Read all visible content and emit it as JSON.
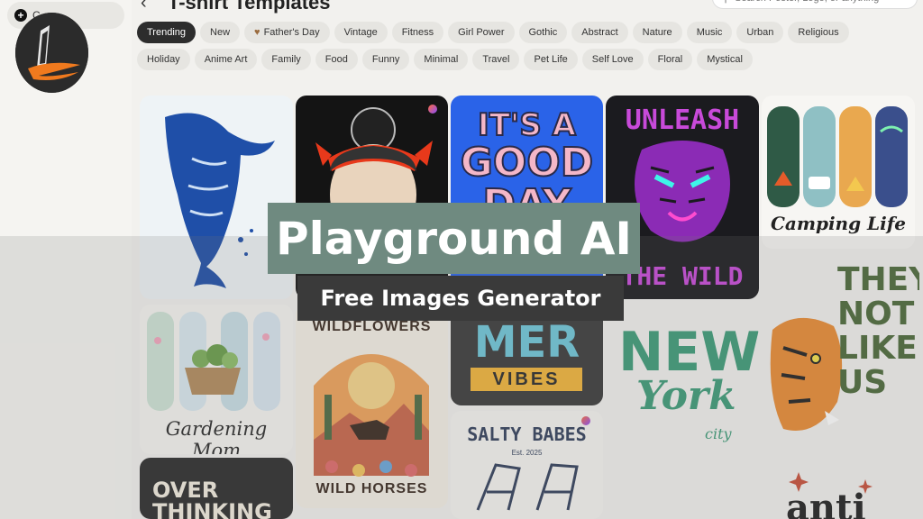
{
  "sidebar": {
    "create_label": "C"
  },
  "header": {
    "title": "T-shirt Templates",
    "search_placeholder": "Search Poster, Logo, or anything"
  },
  "chips_row1": [
    "Trending",
    "New",
    "Father's Day",
    "Vintage",
    "Fitness",
    "Girl Power",
    "Gothic",
    "Abstract",
    "Nature",
    "Music",
    "Urban",
    "Religious"
  ],
  "chips_row2": [
    "Holiday",
    "Anime Art",
    "Family",
    "Food",
    "Funny",
    "Minimal",
    "Travel",
    "Pet Life",
    "Self Love",
    "Floral",
    "Mystical"
  ],
  "active_chip": "Trending",
  "cards": {
    "good_day": [
      "IT'S A",
      "GOOD",
      "DAY"
    ],
    "unleash": "UNLEASH",
    "the_wild": "THE WILD",
    "camping": "Camping Life",
    "gardening": "Gardening Mom",
    "wildflowers": "WILDFLOWERS",
    "wild_horses": "WILD HORSES",
    "mer_vibes_top": "MER",
    "mer_vibes_bottom": "VIBES",
    "new_york": [
      "NEW",
      "York",
      "city"
    ],
    "they_not": [
      "THEY",
      "NOT",
      "LIKE",
      "US"
    ],
    "salty": "SALTY BABES",
    "salty_est": "Est. 2025",
    "over_thinking": [
      "OVER",
      "THINKING"
    ],
    "anti": "anti"
  },
  "banner": {
    "title": "Playground AI",
    "subtitle": "Free Images Generator"
  },
  "colors": {
    "banner_bg": "#6f8a80",
    "subtitle_bg": "#3a3a3a",
    "active_chip": "#2d2d2d",
    "accent_blue": "#1f4fa8"
  }
}
